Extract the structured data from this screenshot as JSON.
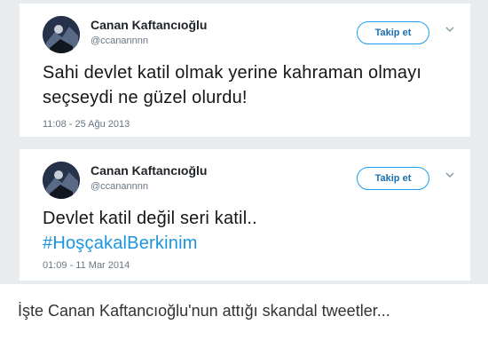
{
  "tweets": [
    {
      "name": "Canan Kaftancıoğlu",
      "handle": "@ccanannnn",
      "follow_label": "Takip et",
      "text": "Sahi devlet katil olmak yerine kahraman olmayı seçseydi ne güzel olurdu!",
      "time": "11:08 - 25 Ağu 2013"
    },
    {
      "name": "Canan Kaftancıoğlu",
      "handle": "@ccanannnn",
      "follow_label": "Takip et",
      "text": "Devlet katil değil seri katil..",
      "hashtag": "#HoşçakalBerkinim",
      "time": "01:09 - 11 Mar 2014"
    }
  ],
  "caption": "İşte Canan Kaftancıoğlu'nun attığı skandal tweetler...",
  "colors": {
    "accent": "#1da1f2",
    "hashtag": "#1b95e0",
    "muted": "#657786",
    "background": "#e9ecef"
  },
  "icons": {
    "more": "chevron-down-icon",
    "avatar": "profile-photo"
  }
}
